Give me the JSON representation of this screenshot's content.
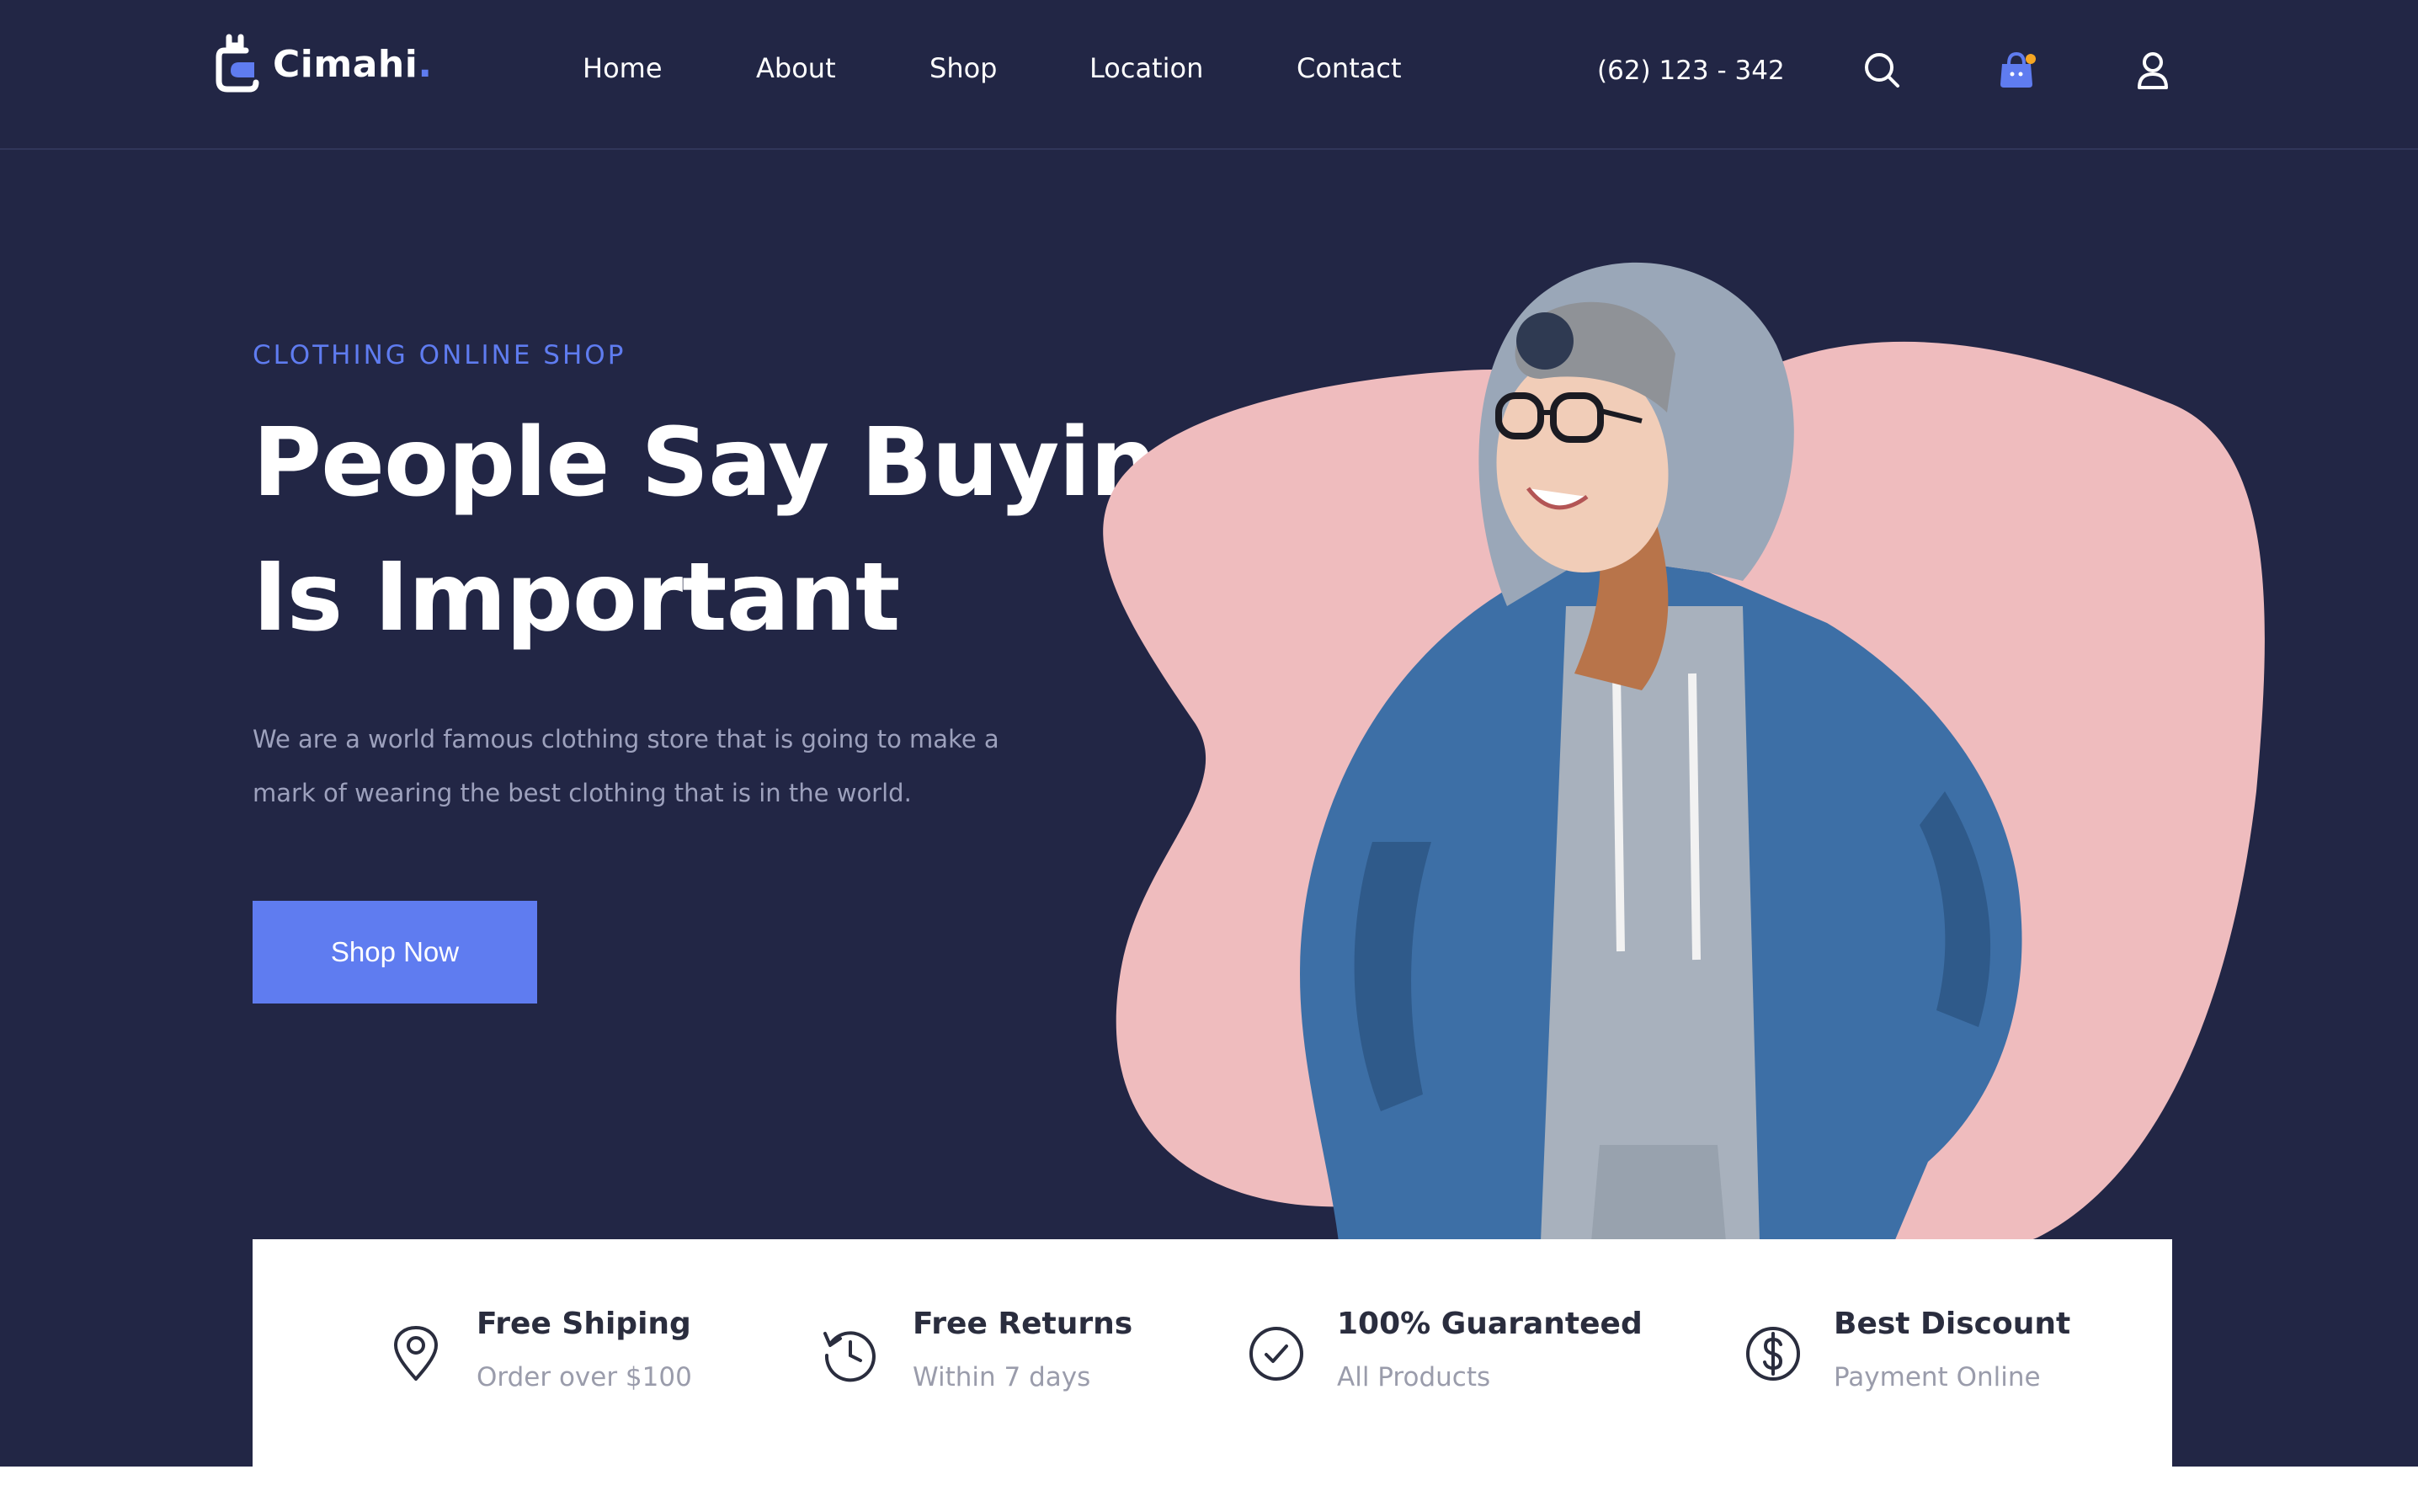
{
  "brand": {
    "name": "Cimahi",
    "dot": ".",
    "accent": "#5f7cf0",
    "background": "#222645",
    "blob": "#efbcbe"
  },
  "nav": {
    "items": [
      "Home",
      "About",
      "Shop",
      "Location",
      "Contact"
    ]
  },
  "header": {
    "phone": "(62) 123 - 342",
    "icons": [
      "search-icon",
      "shopping-bag-icon",
      "user-icon"
    ],
    "cart_dot_color": "#f5a623"
  },
  "hero": {
    "eyebrow": "CLOTHING ONLINE SHOP",
    "headline_line1": "People Say Buying",
    "headline_line2": "Is Important",
    "description": "We are a world famous clothing store that is going to make a mark of wearing the best clothing that is in the world.",
    "cta": "Shop Now"
  },
  "features": [
    {
      "icon": "location-pin-icon",
      "title": "Free Shiping",
      "subtitle": "Order over $100"
    },
    {
      "icon": "history-icon",
      "title": "Free Returns",
      "subtitle": "Within 7 days"
    },
    {
      "icon": "check-circle-icon",
      "title": "100% Guaranteed",
      "subtitle": "All Products"
    },
    {
      "icon": "dollar-circle-icon",
      "title": "Best Discount",
      "subtitle": "Payment Online"
    }
  ]
}
